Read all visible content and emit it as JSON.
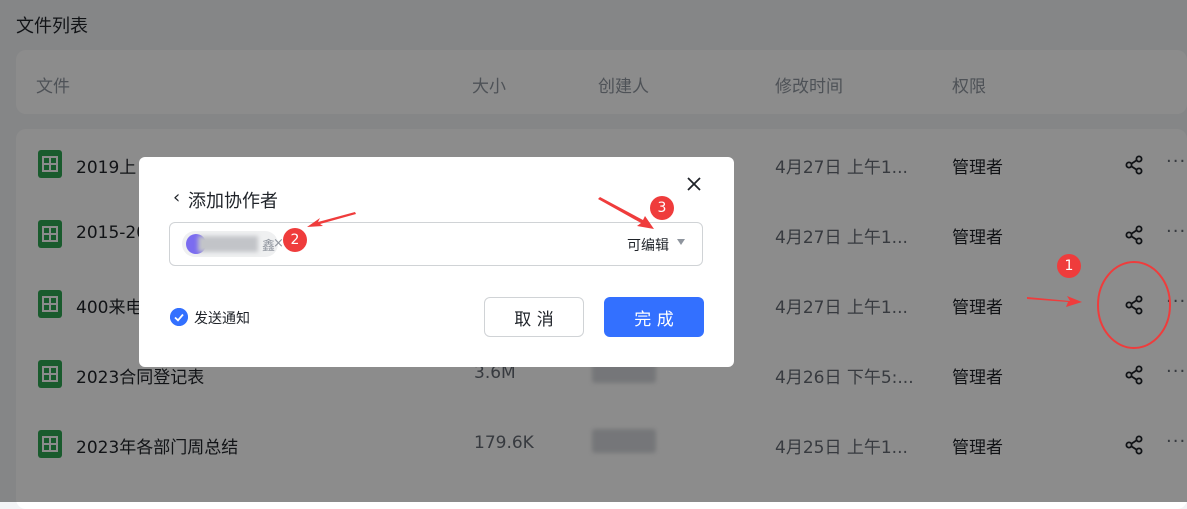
{
  "section_title": "文件列表",
  "columns": {
    "file": "文件",
    "size": "大小",
    "creator": "创建人",
    "modified": "修改时间",
    "permission": "权限"
  },
  "rows": [
    {
      "name": "2019上",
      "size": "",
      "modified": "4月27日 上午1...",
      "permission": "管理者"
    },
    {
      "name": "2015-20",
      "size": "",
      "modified": "4月27日 上午1...",
      "permission": "管理者"
    },
    {
      "name": "400来电",
      "size": "",
      "modified": "4月27日 上午1...",
      "permission": "管理者"
    },
    {
      "name": "2023合同登记表",
      "size": "3.6M",
      "modified": "4月26日 下午5:...",
      "permission": "管理者"
    },
    {
      "name": "2023年各部门周总结",
      "size": "179.6K",
      "modified": "4月25日 上午1...",
      "permission": "管理者"
    }
  ],
  "more_label": "···",
  "dialog": {
    "back_icon": "‹",
    "title": "添加协作者",
    "collaborator_suffix": "鑫",
    "chip_remove": "×",
    "permission": "可编辑",
    "notify_label": "发送通知",
    "cancel": "取 消",
    "done": "完 成"
  },
  "annotations": {
    "badge1": "1",
    "badge2": "2",
    "badge3": "3"
  },
  "colors": {
    "accent": "#3370ff",
    "annotation": "#ef3c3c",
    "sheet_icon": "#2ea653"
  }
}
